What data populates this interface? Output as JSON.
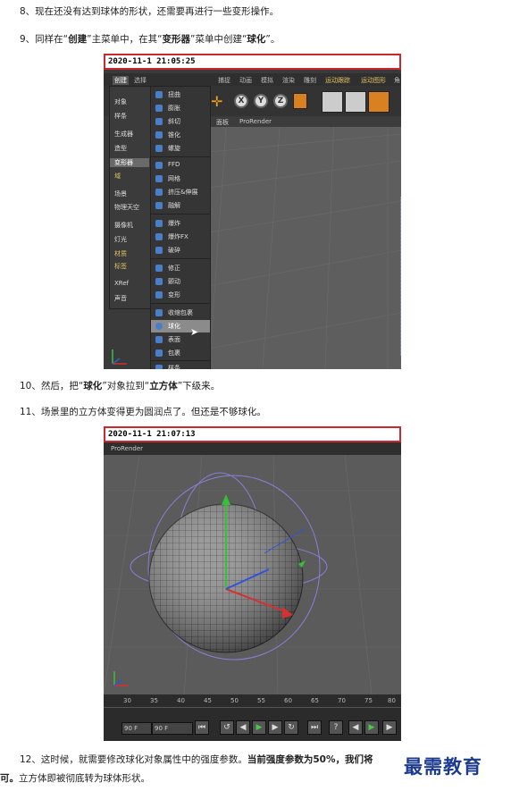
{
  "paragraphs": {
    "p8": "8、现在还没有达到球体的形状，还需要再进行一些变形操作。",
    "p9_a": "9、同样在“",
    "p9_b": "创建",
    "p9_c": "”主菜单中，在其“",
    "p9_d": "变形器",
    "p9_e": "”菜单中创建“",
    "p9_f": "球化",
    "p9_g": "”。",
    "p10_a": "10、然后，把“",
    "p10_b": "球化",
    "p10_c": "”对象拉到“",
    "p10_d": "立方体",
    "p10_e": "”下级来。",
    "p11": "11、场景里的立方体变得更为圆润点了。但还是不够球化。",
    "p12_a": "12、这时候，就需要修改球化对象属性中的强度参数。",
    "p12_b": "当前强度参数为50%，我们将",
    "p12_c": "可。",
    "p12_d": "立方体即被彻底转为球体形状。"
  },
  "shot1": {
    "timestamp": "2020-11-1 21:05:25",
    "top_menu": [
      "创建",
      "选择",
      "捕捉",
      "动画",
      "模拟",
      "渲染",
      "雕刻",
      "运动跟踪",
      "运动图形",
      "角"
    ],
    "viewport_tabs": [
      "面板",
      "ProRender"
    ],
    "create_menu": [
      "对象",
      "样条",
      "生成器",
      "造型",
      "变形器",
      "域",
      "场景",
      "物理天空",
      "摄像机",
      "灯光",
      "材质",
      "标签",
      "XRef",
      "声音"
    ],
    "deformer_menu": [
      "扭曲",
      "膨胀",
      "斜切",
      "锥化",
      "螺旋",
      "FFD",
      "网格",
      "挤压&伸展",
      "融解",
      "爆炸",
      "爆炸FX",
      "破碎",
      "修正",
      "颤动",
      "变形",
      "收缩包裹",
      "球化",
      "表面",
      "包裹",
      "样条"
    ],
    "selected_item": "球化",
    "xyz": [
      "X",
      "Y",
      "Z"
    ]
  },
  "shot2": {
    "timestamp": "2020-11-1 21:07:13",
    "viewport_tab": "ProRender",
    "ticks": [
      "30",
      "35",
      "40",
      "45",
      "50",
      "55",
      "60",
      "65",
      "70",
      "75",
      "80"
    ],
    "frame_start": "90 F",
    "frame_end": "90 F"
  },
  "watermark": "最需教育"
}
